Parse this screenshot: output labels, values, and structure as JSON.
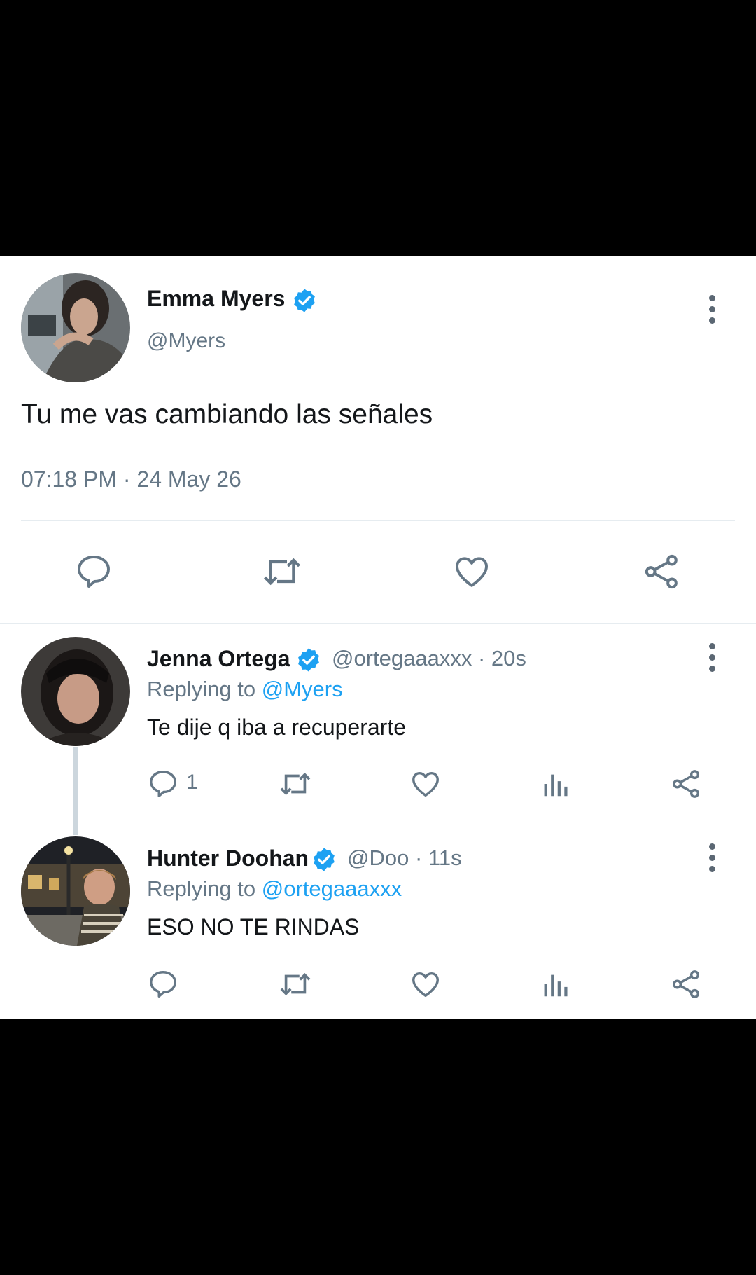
{
  "main_tweet": {
    "name": "Emma Myers",
    "handle": "@Myers",
    "text": "Tu me vas cambiando las señales",
    "timestamp": "07:18 PM · 24 May 26",
    "actions": [
      "comment-icon",
      "retweet-icon",
      "like-icon",
      "share-icon"
    ]
  },
  "replies": [
    {
      "name": "Jenna Ortega",
      "handle": "@ortegaaaxxx · 20s",
      "replying_prefix": "Replying to ",
      "replying_to": "@Myers",
      "text": "Te dije q iba a recuperarte",
      "reply_count": "1"
    },
    {
      "name": "Hunter Doohan",
      "handle": "@Doo · 11s",
      "replying_prefix": "Replying to ",
      "replying_to": "@ortegaaaxxx",
      "text": "ESO NO TE RINDAS",
      "reply_count": ""
    }
  ],
  "colors": {
    "verified": "#1da1f2",
    "icon": "#657786",
    "link": "#1da1f2"
  }
}
